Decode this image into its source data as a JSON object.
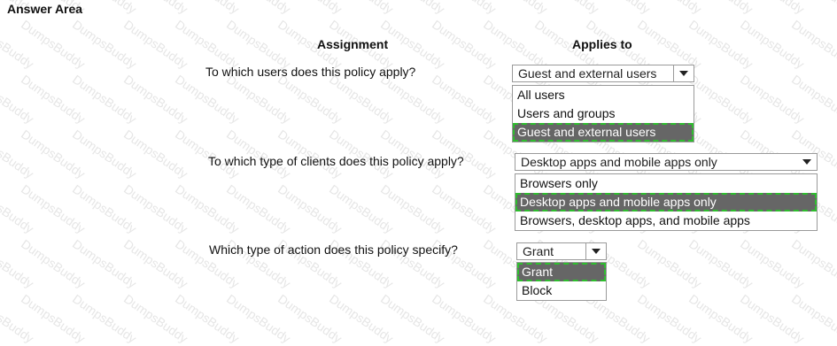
{
  "area_title": "Answer Area",
  "headers": {
    "assignment": "Assignment",
    "applies_to": "Applies to"
  },
  "watermark": "DumpsBuddy",
  "questions": [
    {
      "text": "To which users does this policy apply?",
      "selected": "Guest and external users",
      "options": [
        "All users",
        "Users and groups",
        "Guest and external users"
      ]
    },
    {
      "text": "To which type of clients does this policy apply?",
      "selected": "Desktop apps and mobile apps only",
      "options": [
        "Browsers only",
        "Desktop apps and mobile apps only",
        "Browsers, desktop apps, and mobile apps"
      ]
    },
    {
      "text": "Which type of action does this policy specify?",
      "selected": "Grant",
      "options": [
        "Grant",
        "Block"
      ]
    }
  ],
  "colors": {
    "selected_bg": "#666666",
    "selected_outline": "#2ebd2e"
  }
}
